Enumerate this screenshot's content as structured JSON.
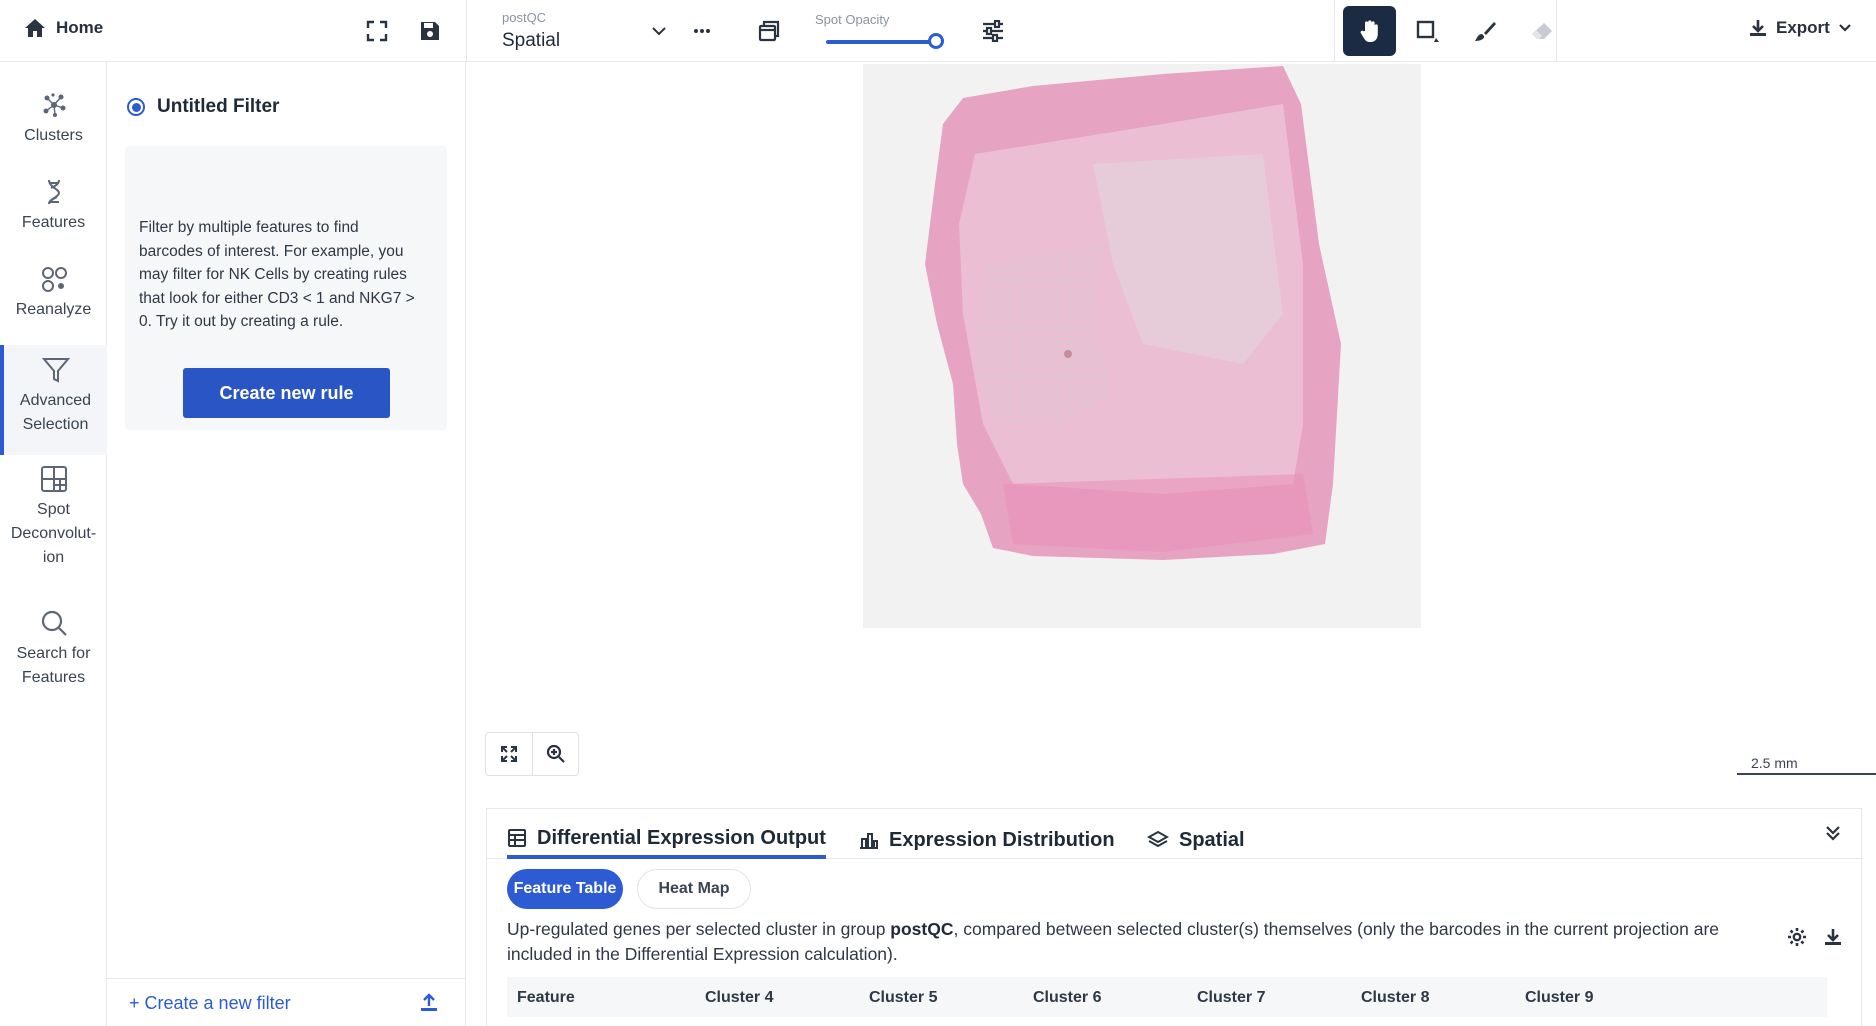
{
  "topbar": {
    "home_label": "Home",
    "projection_caption": "postQC",
    "projection_value": "Spatial",
    "opacity_caption": "Spot Opacity",
    "opacity_value": 1.0,
    "export_label": "Export"
  },
  "nav": {
    "items": [
      {
        "label": "Clusters",
        "icon": "clusters-icon"
      },
      {
        "label": "Features",
        "icon": "dna-icon"
      },
      {
        "label": "Reanalyze",
        "icon": "reanalyze-icon"
      },
      {
        "label": "Advanced Selection",
        "icon": "filter-icon",
        "active": true
      },
      {
        "label": "Spot Deconvolut-ion",
        "icon": "grid-icon"
      },
      {
        "label": "Search for Features",
        "icon": "search-icon"
      }
    ]
  },
  "filter": {
    "title": "Untitled Filter",
    "description": "Filter by multiple features to find barcodes of interest. For example, you may filter for NK Cells by creating rules that look for either CD3 < 1 and NKG7 > 0. Try it out by creating a rule.",
    "create_rule_label": "Create new rule",
    "create_filter_label": "+ Create a new filter"
  },
  "canvas": {
    "scale_label": "2.5 mm"
  },
  "bottom": {
    "tabs": [
      {
        "label": "Differential Expression Output",
        "active": true
      },
      {
        "label": "Expression Distribution"
      },
      {
        "label": "Spatial"
      }
    ],
    "pills": {
      "feature_table": "Feature Table",
      "heat_map": "Heat Map"
    },
    "desc_before": "Up-regulated genes per selected cluster in group ",
    "desc_bold": "postQC",
    "desc_after": ", compared between selected cluster(s) themselves (only the barcodes in the current projection are included in the Differential Expression calculation).",
    "columns": [
      "Feature",
      "Cluster 4",
      "Cluster 5",
      "Cluster 6",
      "Cluster 7",
      "Cluster 8",
      "Cluster 9"
    ]
  },
  "colors": {
    "accent": "#2d5bd4",
    "button": "#2a55c5",
    "active_tool": "#1c2b44",
    "tissue": "#e8a8c4"
  }
}
